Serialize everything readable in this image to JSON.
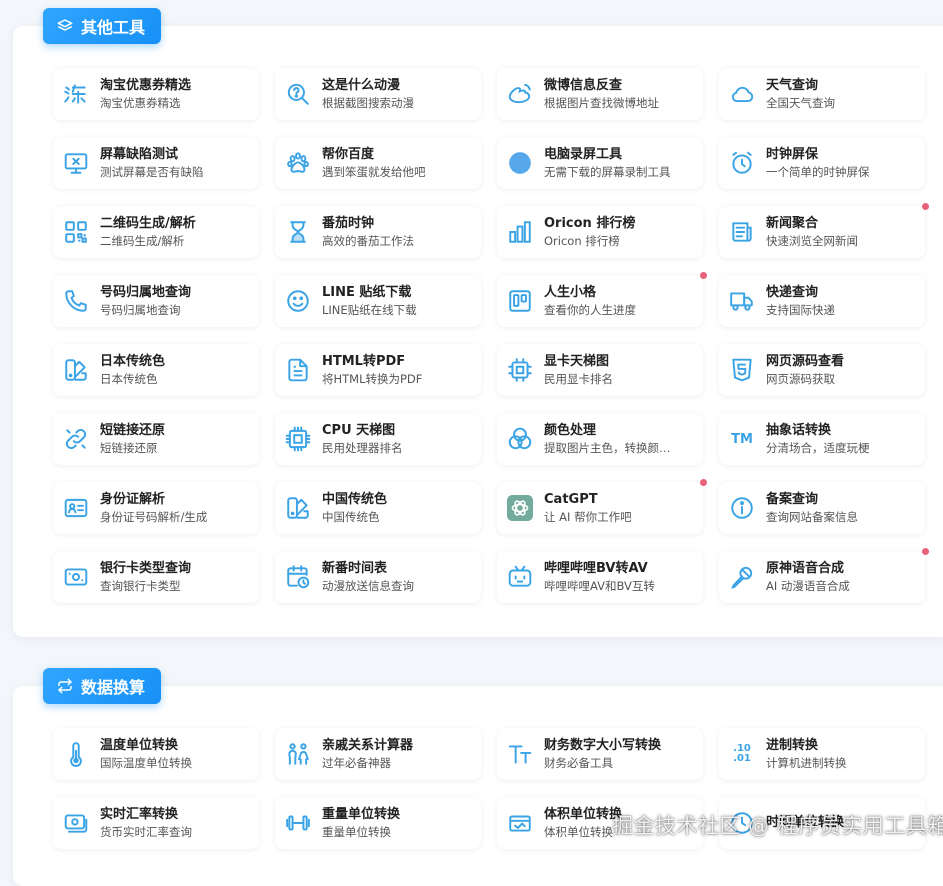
{
  "section1": {
    "title": "其他工具",
    "items": [
      {
        "title": "淘宝优惠券精选",
        "desc": "淘宝优惠券精选",
        "icon": "taobao-icon"
      },
      {
        "title": "这是什么动漫",
        "desc": "根据截图搜索动漫",
        "icon": "search-question-icon"
      },
      {
        "title": "微博信息反查",
        "desc": "根据图片查找微博地址",
        "icon": "weibo-icon"
      },
      {
        "title": "天气查询",
        "desc": "全国天气查询",
        "icon": "cloud-icon"
      },
      {
        "title": "屏幕缺陷测试",
        "desc": "测试屏幕是否有缺陷",
        "icon": "monitor-x-icon"
      },
      {
        "title": "帮你百度",
        "desc": "遇到笨蛋就发给他吧",
        "icon": "paw-icon"
      },
      {
        "title": "电脑录屏工具",
        "desc": "无需下载的屏幕录制工具",
        "icon": "record-dot-icon"
      },
      {
        "title": "时钟屏保",
        "desc": "一个简单的时钟屏保",
        "icon": "alarm-clock-icon"
      },
      {
        "title": "二维码生成/解析",
        "desc": "二维码生成/解析",
        "icon": "qrcode-icon"
      },
      {
        "title": "番茄时钟",
        "desc": "高效的番茄工作法",
        "icon": "hourglass-icon"
      },
      {
        "title": "Oricon 排行榜",
        "desc": "Oricon 排行榜",
        "icon": "bar-chart-icon"
      },
      {
        "title": "新闻聚合",
        "desc": "快速浏览全网新闻",
        "icon": "newspaper-icon",
        "dot": true
      },
      {
        "title": "号码归属地查询",
        "desc": "号码归属地查询",
        "icon": "phone-icon"
      },
      {
        "title": "LINE 贴纸下载",
        "desc": "LINE贴纸在线下载",
        "icon": "smile-icon"
      },
      {
        "title": "人生小格",
        "desc": "查看你的人生进度",
        "icon": "kanban-icon",
        "dot": true
      },
      {
        "title": "快递查询",
        "desc": "支持国际快递",
        "icon": "truck-icon"
      },
      {
        "title": "日本传统色",
        "desc": "日本传统色",
        "icon": "color-swatch-icon"
      },
      {
        "title": "HTML转PDF",
        "desc": "将HTML转换为PDF",
        "icon": "file-text-icon"
      },
      {
        "title": "显卡天梯图",
        "desc": "民用显卡排名",
        "icon": "chip-icon"
      },
      {
        "title": "网页源码查看",
        "desc": "网页源码获取",
        "icon": "html5-icon"
      },
      {
        "title": "短链接还原",
        "desc": "短链接还原",
        "icon": "link-icon"
      },
      {
        "title": "CPU 天梯图",
        "desc": "民用处理器排名",
        "icon": "cpu-icon"
      },
      {
        "title": "颜色处理",
        "desc": "提取图片主色，转换颜…",
        "icon": "color-circles-icon"
      },
      {
        "title": "抽象话转换",
        "desc": "分清场合，适度玩梗",
        "icon": "tm-icon",
        "icon_text": "TM"
      },
      {
        "title": "身份证解析",
        "desc": "身份证号码解析/生成",
        "icon": "id-card-icon"
      },
      {
        "title": "中国传统色",
        "desc": "中国传统色",
        "icon": "color-swatch-icon"
      },
      {
        "title": "CatGPT",
        "desc": "让 AI 帮你工作吧",
        "icon": "openai-icon",
        "dot": true
      },
      {
        "title": "备案查询",
        "desc": "查询网站备案信息",
        "icon": "info-icon"
      },
      {
        "title": "银行卡类型查询",
        "desc": "查询银行卡类型",
        "icon": "bank-card-icon"
      },
      {
        "title": "新番时间表",
        "desc": "动漫放送信息查询",
        "icon": "calendar-clock-icon"
      },
      {
        "title": "哔哩哔哩BV转AV",
        "desc": "哔哩哔哩AV和BV互转",
        "icon": "bilibili-icon"
      },
      {
        "title": "原神语音合成",
        "desc": "AI 动漫语音合成",
        "icon": "microphone-icon",
        "dot": true
      }
    ]
  },
  "section2": {
    "title": "数据换算",
    "items": [
      {
        "title": "温度单位转换",
        "desc": "国际温度单位转换",
        "icon": "thermometer-icon"
      },
      {
        "title": "亲戚关系计算器",
        "desc": "过年必备神器",
        "icon": "people-icon"
      },
      {
        "title": "财务数字大小写转换",
        "desc": "财务必备工具",
        "icon": "text-size-icon"
      },
      {
        "title": "进制转换",
        "desc": "计算机进制转换",
        "icon": "binary-icon",
        "icon_text": ".10\n.01"
      },
      {
        "title": "实时汇率转换",
        "desc": "货币实时汇率查询",
        "icon": "currency-icon"
      },
      {
        "title": "重量单位转换",
        "desc": "重量单位转换",
        "icon": "dumbbell-icon"
      },
      {
        "title": "体积单位转换",
        "desc": "体积单位转换",
        "icon": "volume-icon"
      },
      {
        "title": "时间单位转换",
        "desc": "",
        "icon": "clock-icon"
      }
    ]
  },
  "watermark": "掘金技术社区 @ 程序员实用工具箱",
  "colors": {
    "accent": "#1690f6",
    "icon": "#3aa3e6",
    "dot": "#e7627a"
  }
}
